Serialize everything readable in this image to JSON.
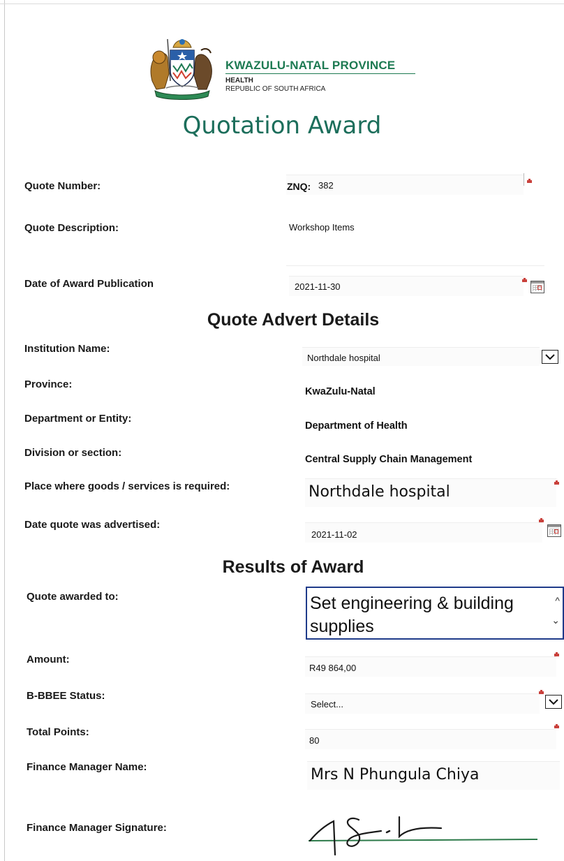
{
  "header": {
    "org_name": "KWAZULU-NATAL PROVINCE",
    "org_dept": "HEALTH",
    "org_country": "REPUBLIC OF SOUTH AFRICA",
    "crest_icon": "coat-of-arms-icon",
    "title": "Quotation Award"
  },
  "quote": {
    "number_label": "Quote Number:",
    "number_prefix": "ZNQ:",
    "number_value": "382",
    "description_label": "Quote Description:",
    "description_value": "Workshop Items",
    "publication_label": "Date of Award Publication",
    "publication_value": "2021-11-30"
  },
  "advert": {
    "section_title": "Quote Advert Details",
    "institution_label": "Institution Name:",
    "institution_value": "Northdale hospital",
    "province_label": "Province:",
    "province_value": "KwaZulu-Natal",
    "department_label": "Department or Entity:",
    "department_value": "Department of Health",
    "division_label": "Division or section:",
    "division_value": "Central Supply Chain Management",
    "place_label": "Place where goods /  services is required:",
    "place_value": "Northdale hospital",
    "advertised_label": "Date quote was advertised:",
    "advertised_value": "2021-11-02"
  },
  "results": {
    "section_title": "Results of Award",
    "awarded_label": "Quote awarded to:",
    "awarded_value": "Set engineering & building supplies",
    "amount_label": "Amount:",
    "amount_value": "R49 864,00",
    "bbbee_label": "B-BBEE Status:",
    "bbbee_value": "Select...",
    "points_label": "Total Points:",
    "points_value": "80",
    "fm_name_label": "Finance Manager Name:",
    "fm_name_value": "Mrs N Phungula Chiya",
    "fm_signature_label": "Finance Manager Signature:"
  },
  "colors": {
    "brand_green": "#1d7a52",
    "title_teal": "#1c6e5b",
    "required_marker": "#c9413c",
    "focus_border": "#1f3b8a"
  }
}
